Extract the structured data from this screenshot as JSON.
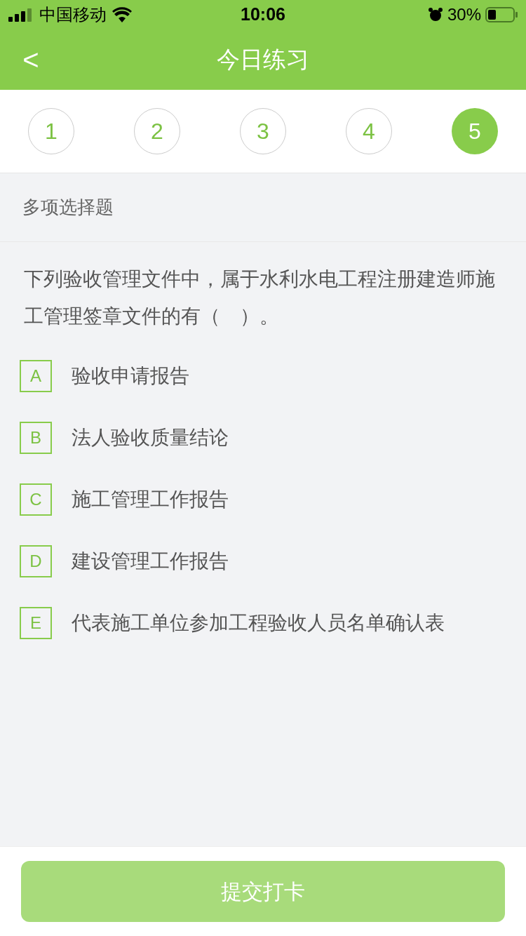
{
  "status_bar": {
    "carrier": "中国移动",
    "time": "10:06",
    "battery": "30%"
  },
  "nav": {
    "back": "<",
    "title": "今日练习"
  },
  "steps": [
    {
      "label": "1",
      "selected": false
    },
    {
      "label": "2",
      "selected": false
    },
    {
      "label": "3",
      "selected": false
    },
    {
      "label": "4",
      "selected": false
    },
    {
      "label": "5",
      "selected": true
    }
  ],
  "question": {
    "type": "多项选择题",
    "text": "下列验收管理文件中，属于水利水电工程注册建造师施工管理签章文件的有（　）。",
    "options": [
      {
        "letter": "A",
        "text": "验收申请报告",
        "checked": false
      },
      {
        "letter": "B",
        "text": "法人验收质量结论",
        "checked": false
      },
      {
        "letter": "C",
        "text": "施工管理工作报告",
        "checked": false
      },
      {
        "letter": "D",
        "text": "建设管理工作报告",
        "checked": false
      },
      {
        "letter": "E",
        "text": "代表施工单位参加工程验收人员名单确认表",
        "checked": false
      }
    ]
  },
  "submit": {
    "label": "提交打卡",
    "disabled": true
  }
}
